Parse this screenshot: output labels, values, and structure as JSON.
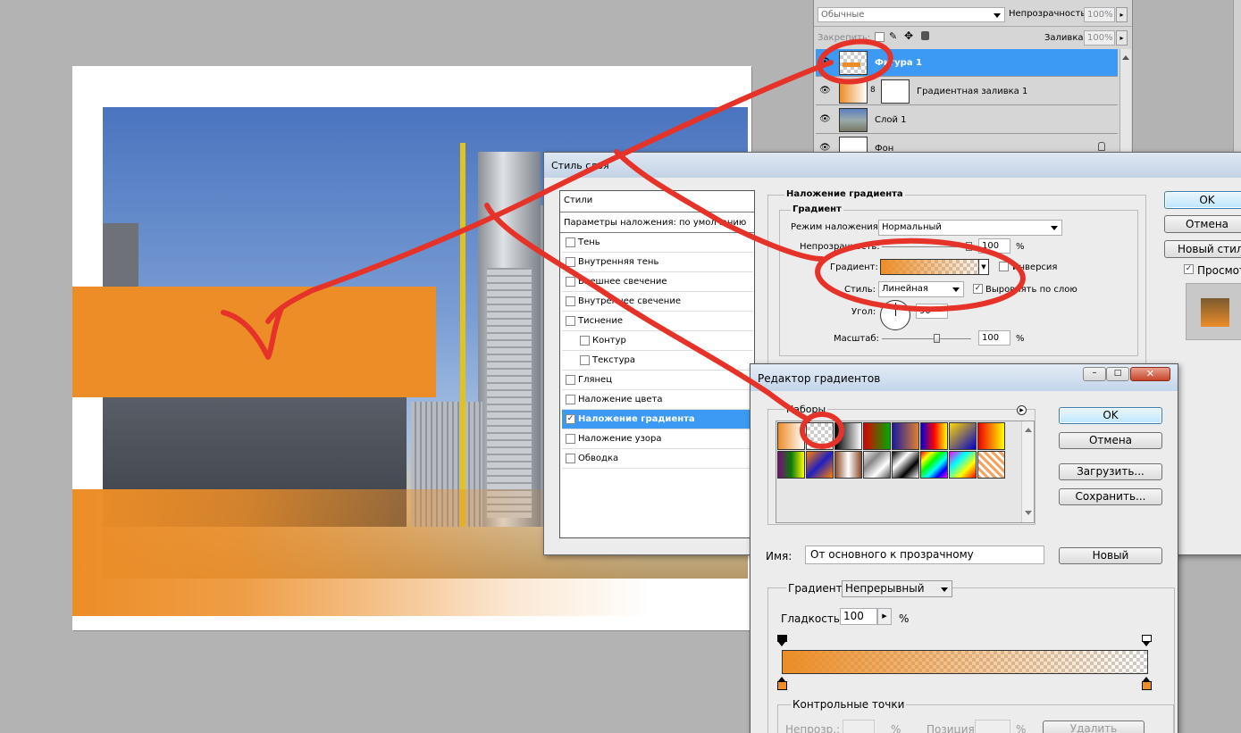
{
  "colors": {
    "orange": "#ec8d27",
    "selection": "#3d9af4",
    "red_annotation": "#e5332a"
  },
  "layers_panel": {
    "blend_mode": "Обычные",
    "opacity_label": "Непрозрачность:",
    "opacity_value": "100%",
    "lock_label": "Закрепить:",
    "fill_label": "Заливка:",
    "fill_value": "100%",
    "layers": [
      {
        "name": "Фигура 1",
        "selected": true
      },
      {
        "name": "Градиентная заливка 1",
        "selected": false
      },
      {
        "name": "Слой 1",
        "selected": false
      },
      {
        "name": "Фон",
        "selected": false
      }
    ]
  },
  "layer_style_dialog": {
    "title": "Стиль слоя",
    "styles_header": "Стили",
    "blending_options": "Параметры наложения: по умолчанию",
    "styles": [
      {
        "label": "Тень",
        "checked": false,
        "indent": false,
        "active": false
      },
      {
        "label": "Внутренняя тень",
        "checked": false,
        "indent": false,
        "active": false
      },
      {
        "label": "Внешнее свечение",
        "checked": false,
        "indent": false,
        "active": false
      },
      {
        "label": "Внутреннее свечение",
        "checked": false,
        "indent": false,
        "active": false
      },
      {
        "label": "Тиснение",
        "checked": false,
        "indent": false,
        "active": false
      },
      {
        "label": "Контур",
        "checked": false,
        "indent": true,
        "active": false
      },
      {
        "label": "Текстура",
        "checked": false,
        "indent": true,
        "active": false
      },
      {
        "label": "Глянец",
        "checked": false,
        "indent": false,
        "active": false
      },
      {
        "label": "Наложение цвета",
        "checked": false,
        "indent": false,
        "active": false
      },
      {
        "label": "Наложение градиента",
        "checked": true,
        "indent": false,
        "active": true
      },
      {
        "label": "Наложение узора",
        "checked": false,
        "indent": false,
        "active": false
      },
      {
        "label": "Обводка",
        "checked": false,
        "indent": false,
        "active": false
      }
    ],
    "section_title": "Наложение градиента",
    "group_title": "Градиент",
    "blend_mode_label": "Режим наложения:",
    "blend_mode_value": "Нормальный",
    "opacity_label": "Непрозрачность:",
    "opacity_value": "100",
    "percent": "%",
    "gradient_label": "Градиент:",
    "reverse_label": "Инверсия",
    "reverse_checked": false,
    "style_label": "Стиль:",
    "style_value": "Линейная",
    "align_label": "Выровнять по слою",
    "align_checked": true,
    "angle_label": "Угол:",
    "angle_value": "90",
    "scale_label": "Масштаб:",
    "scale_value": "100",
    "ok": "OK",
    "cancel": "Отмена",
    "new_style": "Новый стиль...",
    "preview_label": "Просмотр",
    "preview_checked": true
  },
  "gradient_editor": {
    "title": "Редактор градиентов",
    "presets_label": "Наборы",
    "ok": "OK",
    "cancel": "Отмена",
    "load": "Загрузить...",
    "save": "Сохранить...",
    "name_label": "Имя:",
    "name_value": "От основного к прозрачному",
    "new_button": "Новый",
    "type_label": "Градиент:",
    "type_value": "Непрерывный",
    "smoothness_label": "Гладкость:",
    "smoothness_value": "100",
    "percent": "%",
    "stops_group": "Контрольные точки",
    "stop_opacity_label": "Непрозр.:",
    "stop_position_label": "Позиция:",
    "delete_button": "Удалить",
    "presets": [
      "linear-gradient(90deg,#ec8d27,#fff)",
      "transparent",
      "linear-gradient(90deg,#000,#fff)",
      "linear-gradient(90deg,#d00,#0a0)",
      "linear-gradient(90deg,#1a1aa0,#e08030)",
      "linear-gradient(90deg,#00d,#f00,#ff0)",
      "linear-gradient(135deg,#ffd700,#0000cc)",
      "linear-gradient(90deg,#e00,#ff0)",
      "linear-gradient(90deg,#7a0a7a,#0a7a0a,#ff0)",
      "linear-gradient(135deg,#ff8000,#2020c0,#ff8000)",
      "linear-gradient(90deg,#8a4a2a,#fff,#8a4a2a)",
      "linear-gradient(135deg,#eee,#888,#fff,#555)",
      "linear-gradient(135deg,#000,#fff,#000,#fff)",
      "linear-gradient(135deg,#f00,#ff0,#0f0,#0ff,#00f,#f0f)",
      "linear-gradient(135deg,#f0f,#0ff,#ff0,#f00)",
      "repeating-linear-gradient(45deg,#f4a460 0 3px,#fff 3px 6px)"
    ]
  }
}
